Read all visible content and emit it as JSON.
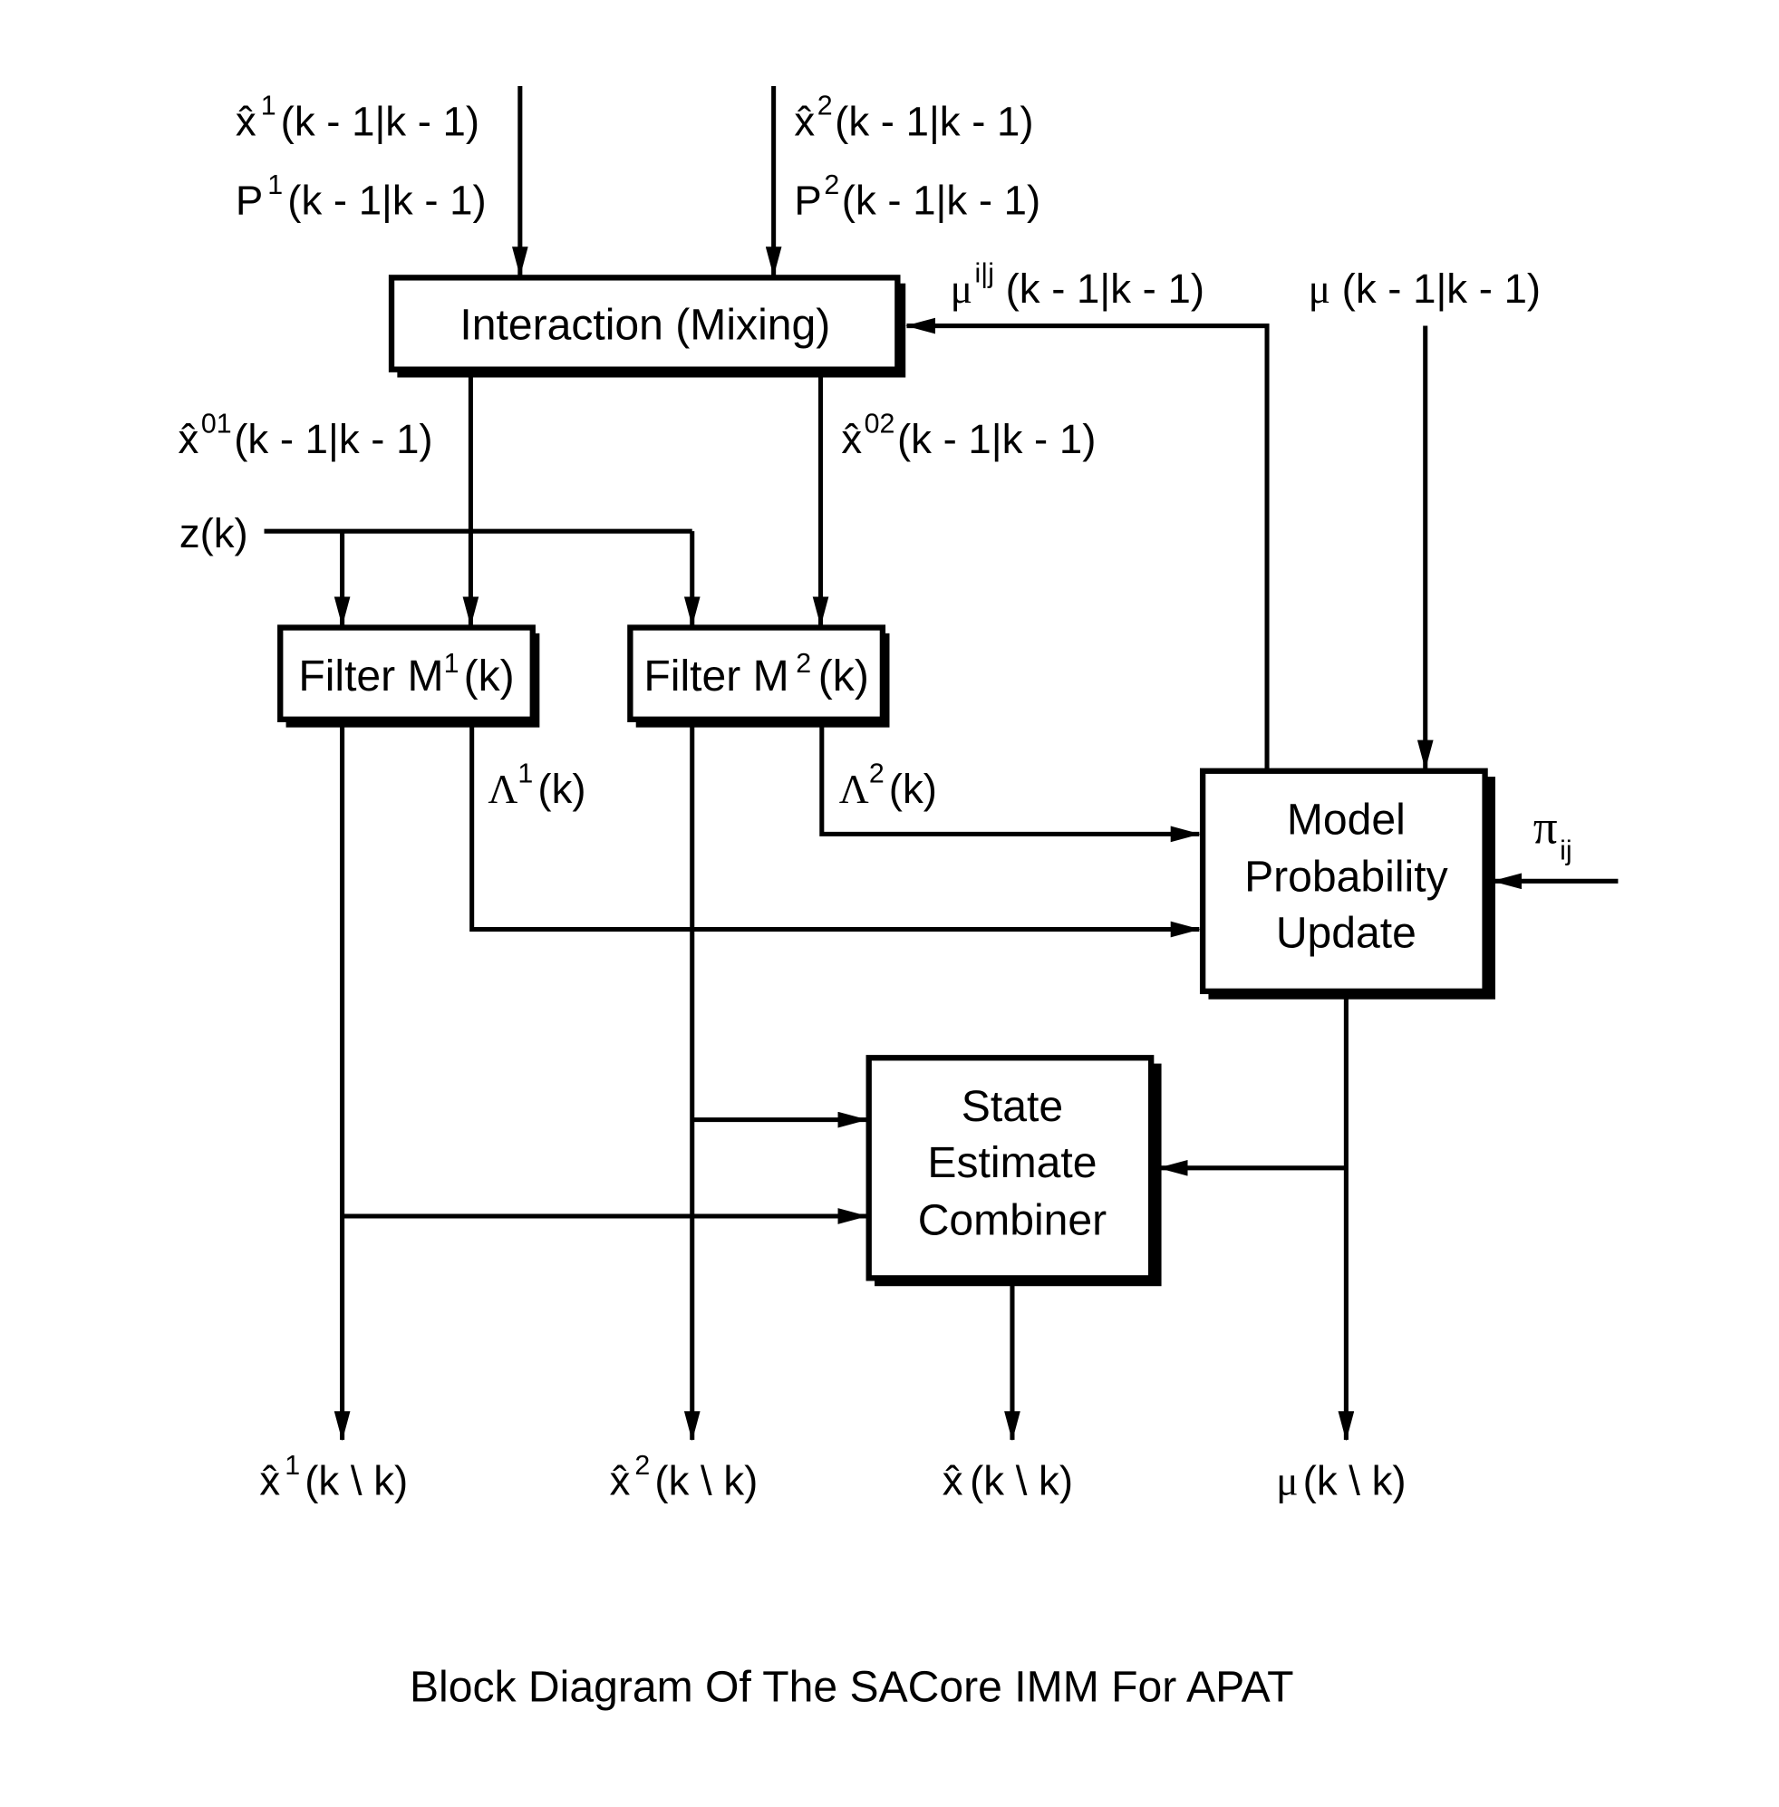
{
  "diagram": {
    "caption": "Block Diagram Of The SACore IMM For APAT",
    "blocks": {
      "interaction": "Interaction (Mixing)",
      "filter1": {
        "prefix": "Filter M",
        "sup": "1",
        "suffix": "(k)"
      },
      "filter2": {
        "prefix": "Filter M",
        "sup": "2",
        "suffix": "(k)"
      },
      "model_prob": [
        "Model",
        "Probability",
        "Update"
      ],
      "combiner": [
        "State",
        "Estimate",
        "Combiner"
      ]
    },
    "inputs": {
      "x1_prev": {
        "base": "x̂",
        "sup": "1",
        "arg": "(k - 1|k - 1)"
      },
      "p1_prev": {
        "base": "P",
        "sup": "1",
        "arg": "(k - 1|k - 1)"
      },
      "x2_prev": {
        "base": "x̂",
        "sup": "2",
        "arg": "(k - 1|k - 1)"
      },
      "p2_prev": {
        "base": "P",
        "sup": "2",
        "arg": "(k - 1|k - 1)"
      },
      "mu_ij": {
        "base": "μ",
        "sup": "i|j",
        "arg": "(k - 1|k - 1)"
      },
      "mu_prev": {
        "base": "μ",
        "arg": "(k - 1|k - 1)"
      },
      "z": "z(k)",
      "pi_ij": {
        "base": "π",
        "sub": "ij"
      }
    },
    "intermediate": {
      "x01": {
        "base": "x̂",
        "sup": "01",
        "arg": "(k - 1|k - 1)"
      },
      "x02": {
        "base": "x̂",
        "sup": "02",
        "arg": "(k - 1|k - 1)"
      },
      "lambda1": {
        "base": "Λ",
        "sup": "1",
        "arg": "(k)"
      },
      "lambda2": {
        "base": "Λ",
        "sup": "2",
        "arg": "(k)"
      }
    },
    "outputs": {
      "x1": {
        "base": "x̂",
        "sup": "1",
        "arg": "(k \\ k)"
      },
      "x2": {
        "base": "x̂",
        "sup": "2",
        "arg": "(k \\ k)"
      },
      "x": {
        "base": "x̂",
        "arg": "(k \\ k)"
      },
      "mu": {
        "base": "μ",
        "arg": "(k \\ k)"
      }
    }
  }
}
